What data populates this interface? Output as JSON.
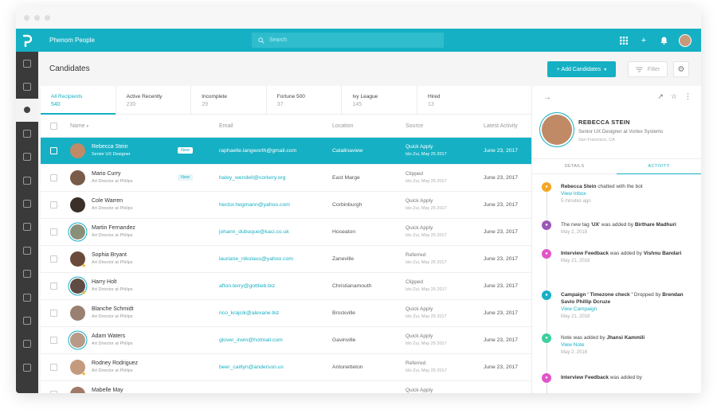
{
  "app": {
    "title": "Phenom People",
    "search_placeholder": "Search"
  },
  "page": {
    "title": "Candidates"
  },
  "toolbar": {
    "add_label": "+ Add Candidates",
    "filter_label": "Filter"
  },
  "tabs": [
    {
      "label": "All Recipients",
      "count": "540"
    },
    {
      "label": "Active Recently",
      "count": "230"
    },
    {
      "label": "Incomplete",
      "count": "29"
    },
    {
      "label": "Fortune 500",
      "count": "37"
    },
    {
      "label": "Ivy League",
      "count": "145"
    },
    {
      "label": "Hired",
      "count": "13"
    }
  ],
  "columns": {
    "name": "Name",
    "email": "Email",
    "location": "Location",
    "source": "Source",
    "activity": "Latest Activity"
  },
  "rows": [
    {
      "name": "Rebecca Stein",
      "title": "Senior UX Designer",
      "badge": "New",
      "email": "raphaelle.langworth@gmail.com",
      "location": "Catalinaview",
      "source": "Quick Apply",
      "source_date": "Ido Zui, May 25 2017",
      "date": "June 23, 2017"
    },
    {
      "name": "Mario Curry",
      "title": "Art Director at Philips",
      "badge": "New",
      "email": "haley_wendell@corkery.org",
      "location": "East Marge",
      "source": "Clipped",
      "source_date": "Ido Zui, May 25 2017",
      "date": "June 23, 2017"
    },
    {
      "name": "Cole Warren",
      "title": "Art Director at Philips",
      "badge": "",
      "email": "hector.hegmann@yahoo.com",
      "location": "Corbinburgh",
      "source": "Quick Apply",
      "source_date": "Ido Zui, May 25 2017",
      "date": "June 23, 2017"
    },
    {
      "name": "Martin Fernandez",
      "title": "Art Director at Philips",
      "badge": "",
      "email": "johann_dubuque@kaci.co.uk",
      "location": "Hoseaton",
      "source": "Quick Apply",
      "source_date": "Ido Zui, May 25 2017",
      "date": "June 23, 2017"
    },
    {
      "name": "Sophia Bryant",
      "title": "Art Director at Philips",
      "badge": "",
      "email": "lauriane_nikolaus@yahoo.com",
      "location": "Zaneville",
      "source": "Referred",
      "source_date": "Ido Zui, May 25 2017",
      "date": "June 23, 2017"
    },
    {
      "name": "Harry Holt",
      "title": "Art Director at Philips",
      "badge": "",
      "email": "afton.terry@gottlieb.biz",
      "location": "Christianamouth",
      "source": "Clipped",
      "source_date": "Ido Zui, May 25 2017",
      "date": "June 23, 2017"
    },
    {
      "name": "Blanche Schmidt",
      "title": "Art Director at Philips",
      "badge": "",
      "email": "rico_krajcik@alexane.biz",
      "location": "Brockville",
      "source": "Quick Apply",
      "source_date": "Ido Zui, May 25 2017",
      "date": "June 23, 2017"
    },
    {
      "name": "Adam Waters",
      "title": "Art Director at Philips",
      "badge": "",
      "email": "glover_irwin@hotmail.com",
      "location": "Gavinville",
      "source": "Quick Apply",
      "source_date": "Ido Zui, May 25 2017",
      "date": "June 23, 2017"
    },
    {
      "name": "Rodney Rodriguez",
      "title": "Art Director at Philips",
      "badge": "",
      "email": "beer_caitlyn@anderson.us",
      "location": "Antonetteton",
      "source": "Referred",
      "source_date": "Ido Zui, May 25 2017",
      "date": "June 23, 2017"
    },
    {
      "name": "Mabelle May",
      "title": "",
      "badge": "",
      "email": "",
      "location": "",
      "source": "Quick Apply",
      "source_date": "",
      "date": ""
    }
  ],
  "detail": {
    "name": "REBECCA STEIN",
    "role": "Senior UX Designer at Vortex Systems",
    "location": "San Francisco, CA",
    "tabs": [
      "DETAILS",
      "ACTIVITY"
    ],
    "activity": [
      {
        "pre": "",
        "bold": "Rebecca Stein",
        "mid": " chatted with the bot",
        "bold2": "",
        "post": "",
        "link": "View Inbox",
        "time": "5 minutes ago",
        "color": "#f5a623"
      },
      {
        "pre": "The new tag '",
        "bold": "UX",
        "mid": "' was added by ",
        "bold2": "Birthare Madhuri",
        "post": "",
        "link": "",
        "time": "May 2, 2018",
        "color": "#9b59b6"
      },
      {
        "pre": "",
        "bold": "Interview Feedback",
        "mid": " was added by ",
        "bold2": "Vishnu Bandari",
        "post": "",
        "link": "",
        "time": "May 21, 2018",
        "color": "#e056c9"
      },
      {
        "pre": "",
        "bold": "Campaign ' Timezone check '",
        "mid": " Dropped by ",
        "bold2": "Brendan Savio Phillip Dcruze",
        "post": "",
        "link": "View Campaign",
        "time": "May 21, 2018",
        "color": "#16b0c4"
      },
      {
        "pre": "Note was added by ",
        "bold": "Jhansi Kammili",
        "mid": "",
        "bold2": "",
        "post": "",
        "link": "View Note",
        "time": "May 2, 2018",
        "color": "#3ccfa0"
      },
      {
        "pre": "",
        "bold": "Interview Feedback",
        "mid": " was added by",
        "bold2": "",
        "post": "",
        "link": "",
        "time": "",
        "color": "#e056c9"
      }
    ]
  }
}
